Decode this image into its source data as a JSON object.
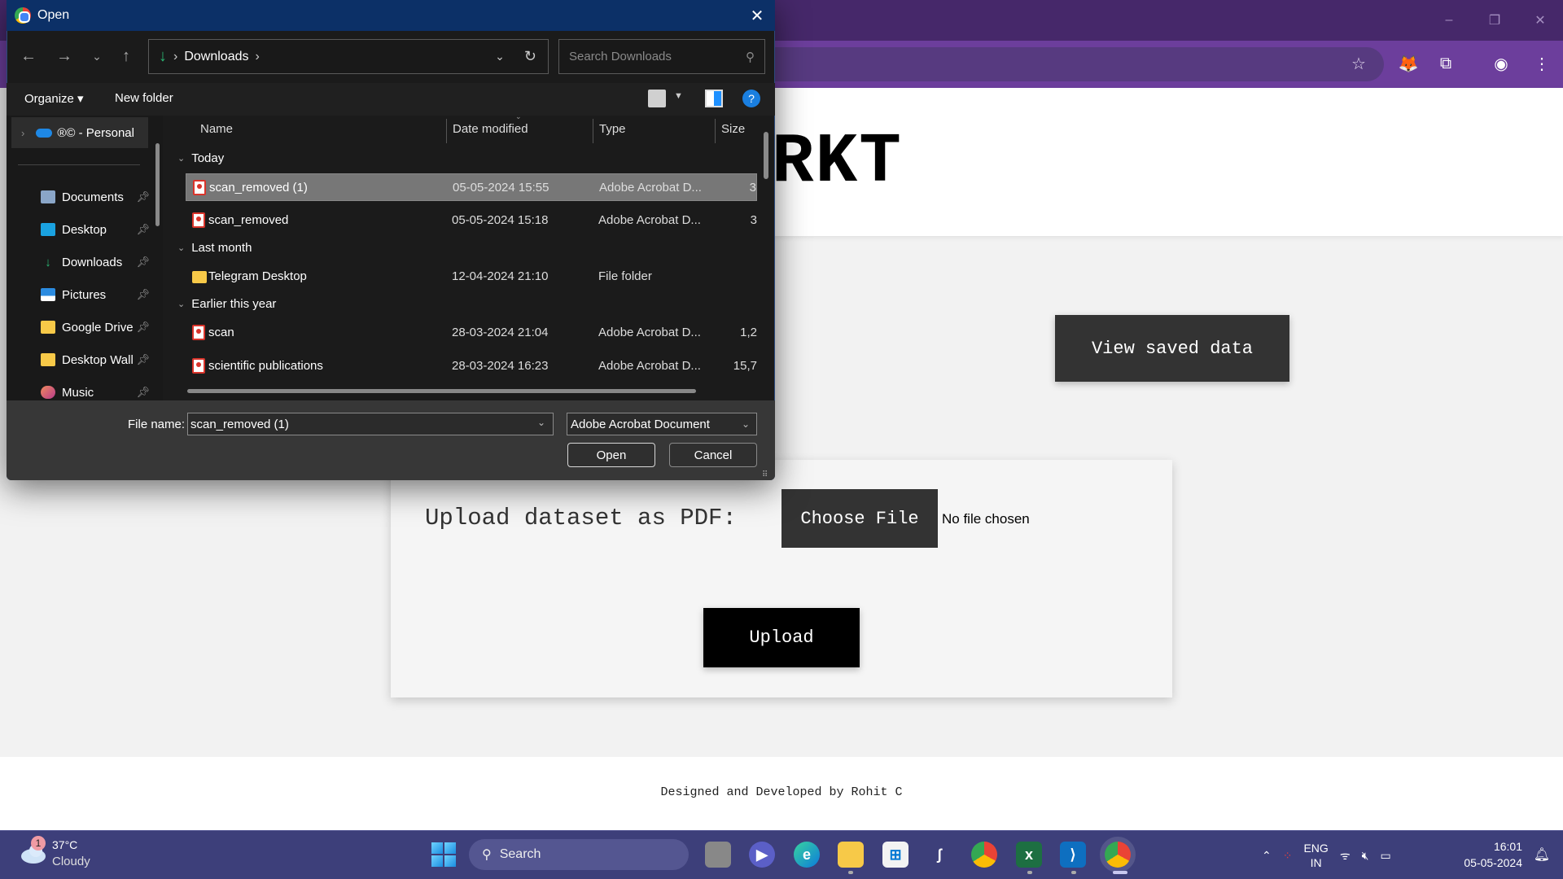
{
  "browser": {
    "window_controls": {
      "minimize": "–",
      "restore": "❐",
      "close": "✕"
    },
    "toolbar_icons": [
      "bookmark-star",
      "metamask-extension",
      "extensions-puzzle",
      "profile-avatar",
      "menu-kebab"
    ]
  },
  "page": {
    "logo_visible": "RKT",
    "view_saved_label": "View saved data",
    "upload_label": "Upload dataset as PDF:",
    "choose_file_label": "Choose File",
    "no_file_text": "No file chosen",
    "upload_button": "Upload",
    "footer": "Designed and Developed by Rohit C"
  },
  "dialog": {
    "title": "Open",
    "close": "✕",
    "nav": {
      "back": "←",
      "forward": "→",
      "recent": "⌄",
      "up": "↑"
    },
    "breadcrumb": [
      "Downloads"
    ],
    "search_placeholder": "Search Downloads",
    "commands": {
      "organize": "Organize ▾",
      "new_folder": "New folder",
      "help": "?"
    },
    "nav_pane": {
      "cloud": "®© - Personal",
      "items": [
        {
          "label": "Documents",
          "icon": "documents-icon",
          "pinned": true
        },
        {
          "label": "Desktop",
          "icon": "desktop-icon",
          "pinned": true
        },
        {
          "label": "Downloads",
          "icon": "downloads-icon",
          "pinned": true
        },
        {
          "label": "Pictures",
          "icon": "pictures-icon",
          "pinned": true
        },
        {
          "label": "Google Drive",
          "icon": "folder-icon",
          "pinned": true
        },
        {
          "label": "Desktop Wall",
          "icon": "folder-icon",
          "pinned": true
        },
        {
          "label": "Music",
          "icon": "music-icon",
          "pinned": true
        }
      ]
    },
    "columns": {
      "name": "Name",
      "date": "Date modified",
      "type": "Type",
      "size": "Size"
    },
    "groups": [
      {
        "label": "Today",
        "files": [
          {
            "name": "scan_removed (1)",
            "date": "05-05-2024 15:55",
            "type": "Adobe Acrobat D...",
            "size": "3",
            "kind": "pdf",
            "selected": true
          },
          {
            "name": "scan_removed",
            "date": "05-05-2024 15:18",
            "type": "Adobe Acrobat D...",
            "size": "3",
            "kind": "pdf",
            "selected": false
          }
        ]
      },
      {
        "label": "Last month",
        "files": [
          {
            "name": "Telegram Desktop",
            "date": "12-04-2024 21:10",
            "type": "File folder",
            "size": "",
            "kind": "folder",
            "selected": false
          }
        ]
      },
      {
        "label": "Earlier this year",
        "files": [
          {
            "name": "scan",
            "date": "28-03-2024 21:04",
            "type": "Adobe Acrobat D...",
            "size": "1,2",
            "kind": "pdf",
            "selected": false
          },
          {
            "name": "scientific publications",
            "date": "28-03-2024 16:23",
            "type": "Adobe Acrobat D...",
            "size": "15,7",
            "kind": "pdf",
            "selected": false
          }
        ]
      }
    ],
    "file_name_label": "File name:",
    "file_name_value": "scan_removed (1)",
    "file_type": "Adobe Acrobat Document",
    "open_label": "Open",
    "cancel_label": "Cancel"
  },
  "taskbar": {
    "weather": {
      "badge": "1",
      "temp": "37°C",
      "desc": "Cloudy"
    },
    "search_label": "Search",
    "apps": [
      "task-view",
      "teams-chat",
      "edge",
      "file-explorer",
      "microsoft-store",
      "app-s",
      "chrome",
      "excel",
      "vscode",
      "chrome-profile"
    ],
    "tray": {
      "lang_top": "ENG",
      "lang_bottom": "IN"
    },
    "clock": {
      "time": "16:01",
      "date": "05-05-2024"
    }
  }
}
